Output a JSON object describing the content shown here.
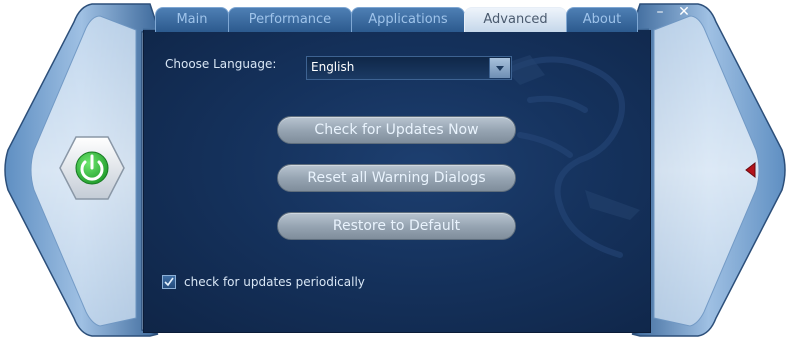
{
  "tabs": [
    {
      "label": "Main"
    },
    {
      "label": "Performance"
    },
    {
      "label": "Applications"
    },
    {
      "label": "Advanced"
    },
    {
      "label": "About"
    }
  ],
  "active_tab": "Advanced",
  "window_controls": {
    "minimize": "–",
    "close": "✕"
  },
  "language": {
    "label": "Choose Language:",
    "selected": "English"
  },
  "buttons": {
    "check_updates": "Check for Updates Now",
    "reset_warnings": "Reset all Warning Dialogs",
    "restore_default": "Restore to Default"
  },
  "periodic_check": {
    "label": "check for updates periodically",
    "checked": true
  },
  "icons": {
    "power": "power-icon",
    "collapse": "collapse-arrow-icon",
    "dropdown": "chevron-down-icon",
    "checkmark": "checkmark-icon",
    "watermark": "dragon-icon"
  },
  "colors": {
    "panel": "#15325d",
    "power_green": "#2eb83a",
    "collapse_red": "#b3121a",
    "button_text": "#e9f3fd"
  }
}
